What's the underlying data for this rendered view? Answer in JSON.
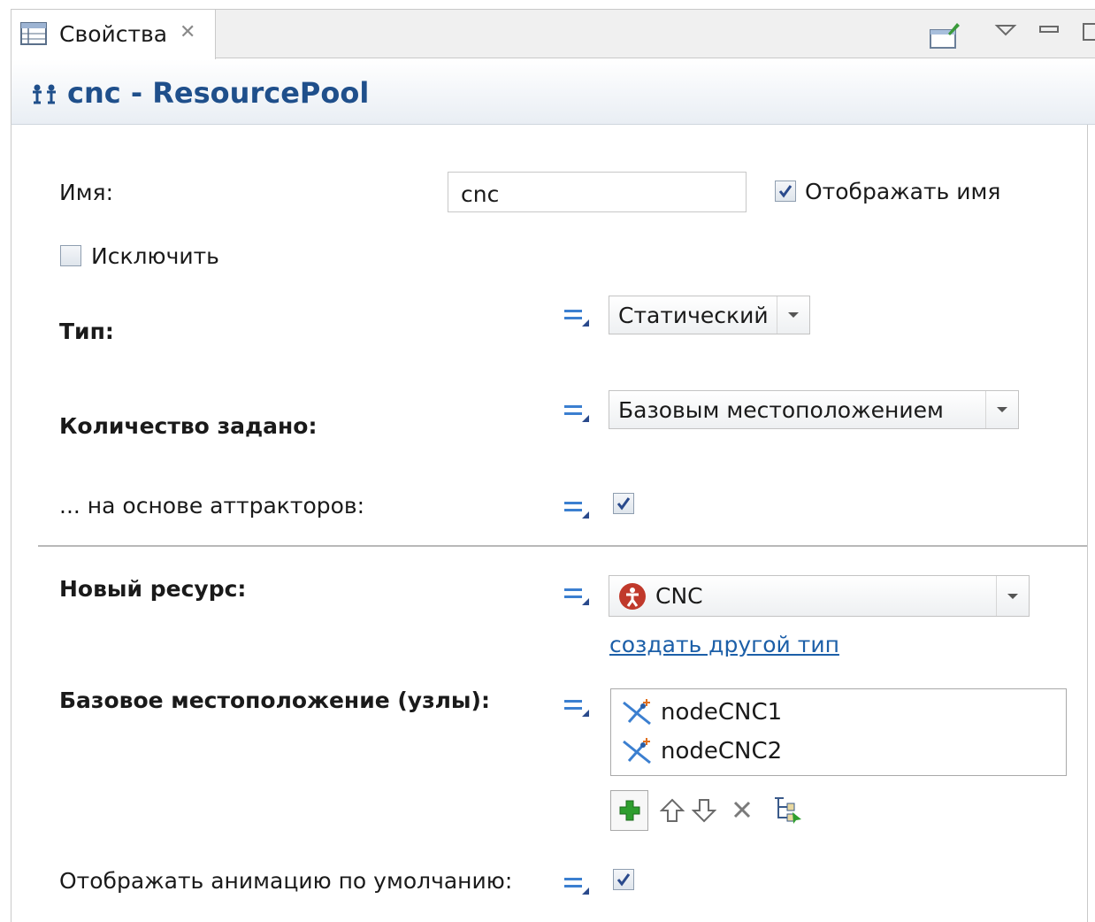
{
  "tab": {
    "label": "Свойства"
  },
  "header": {
    "title": "cnc - ResourcePool"
  },
  "form": {
    "name_label": "Имя:",
    "name_value": "cnc",
    "show_name_label": "Отображать имя",
    "show_name_checked": true,
    "exclude_label": "Исключить",
    "exclude_checked": false,
    "type_label": "Тип:",
    "type_value": "Статический",
    "quantity_label": "Количество задано:",
    "quantity_value": "Базовым местоположением",
    "attractors_label": "... на основе аттракторов:",
    "attractors_checked": true,
    "new_resource_label": "Новый ресурс:",
    "new_resource_value": "CNC",
    "create_type_link": "создать другой тип",
    "home_location_label": "Базовое местоположение (узлы):",
    "home_location_items": [
      "nodeCNC1",
      "nodeCNC2"
    ],
    "show_animation_label": "Отображать анимацию по умолчанию:",
    "show_animation_checked": true
  },
  "colors": {
    "title": "#1f4f8b",
    "link": "#1c5fa8",
    "add_button": "#2e9e2e",
    "resource_icon": "#c0392b"
  }
}
